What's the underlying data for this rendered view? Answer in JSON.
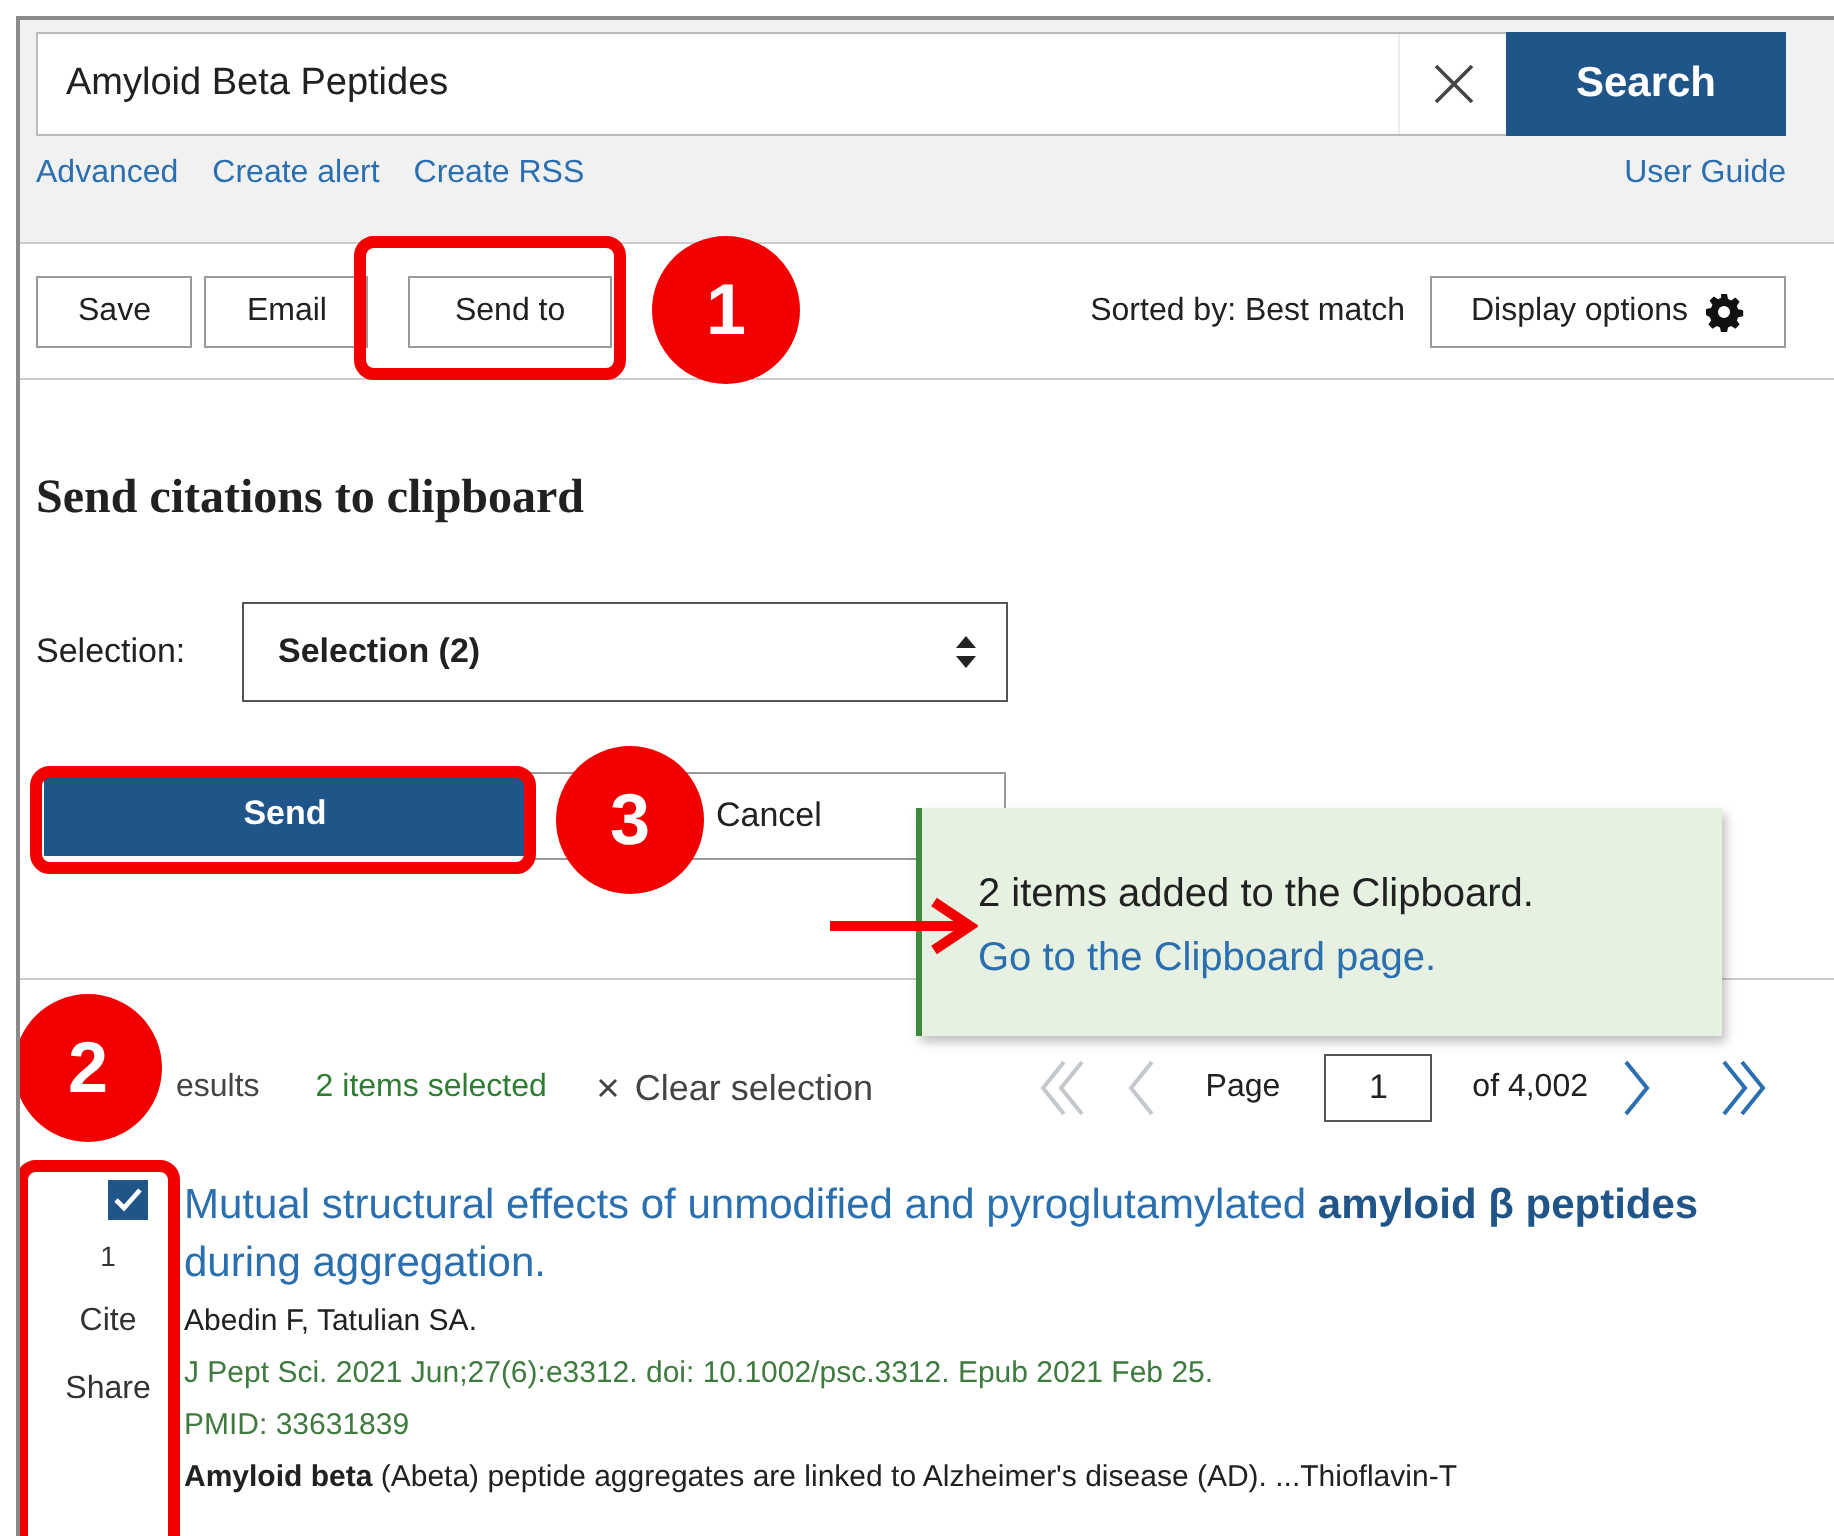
{
  "search": {
    "value": "Amyloid Beta Peptides",
    "button": "Search",
    "links": [
      "Advanced",
      "Create alert",
      "Create RSS"
    ],
    "guide": "User Guide"
  },
  "toolbar": {
    "buttons": [
      "Save",
      "Email",
      "Send to"
    ],
    "sorted": "Sorted by: Best match",
    "display": "Display options"
  },
  "send_panel": {
    "title": "Send citations to clipboard",
    "selection_label": "Selection:",
    "selection_value": "Selection (2)",
    "send": "Send",
    "cancel": "Cancel"
  },
  "toast": {
    "text": "2 items added to the Clipboard. ",
    "link": "Go to the Clipboard page."
  },
  "results_bar": {
    "results": "esults",
    "selected": "2 items selected",
    "clear": "Clear selection",
    "page_label": "Page",
    "page": "1",
    "of": "of 4,002",
    "nav": [
      {
        "kind": "first",
        "disabled": true
      },
      {
        "kind": "prev",
        "disabled": true
      },
      {
        "kind": "next",
        "disabled": false
      },
      {
        "kind": "last",
        "disabled": false
      }
    ]
  },
  "article": {
    "checked": true,
    "number": "1",
    "cite": "Cite",
    "share": "Share",
    "title": "Mutual structural effects of unmodified and pyroglutamylated **amyloid β peptides** during aggregation.",
    "authors": "Abedin F, Tatulian SA.",
    "journal": "J Pept Sci. 2021 Jun;27(6):e3312. doi: 10.1002/psc.3312. Epub 2021 Feb 25.",
    "pmid": "PMID: 33631839",
    "snippet": "**Amyloid beta** (Abeta) peptide aggregates are linked to Alzheimer's disease (AD). ...Thioflavin-T"
  },
  "annotations": [
    "1",
    "2",
    "3"
  ]
}
